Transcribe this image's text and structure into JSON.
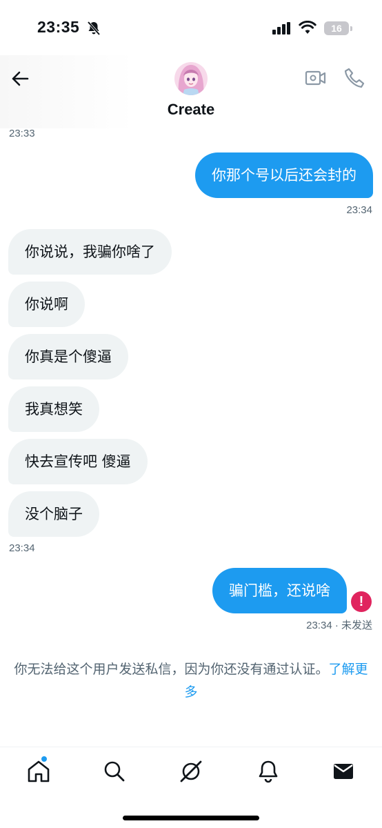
{
  "status_bar": {
    "time": "23:35",
    "battery": "16"
  },
  "header": {
    "contact_name": "Create",
    "icons": [
      "back-arrow-icon",
      "video-call-icon",
      "phone-call-icon"
    ]
  },
  "messages": {
    "first_timestamp": "23:33",
    "out_1": {
      "text": "你那个号以后还会封的",
      "time": "23:34"
    },
    "incoming": [
      "你说说，我骗你啥了",
      "你说啊",
      "你真是个傻逼",
      "我真想笑",
      "快去宣传吧 傻逼",
      "没个脑子"
    ],
    "incoming_time": "23:34",
    "out_2": {
      "text": "骗门槛，还说啥",
      "time": "23:34 · 未发送"
    }
  },
  "notice": {
    "text": "你无法给这个用户发送私信，因为你还没有通过认证。",
    "link": "了解更多"
  },
  "colors": {
    "accent": "#1d9bf0",
    "incoming_bubble": "#eff3f4",
    "error": "#e0245e"
  },
  "nav": [
    "home-icon",
    "search-icon",
    "grok-icon",
    "notifications-icon",
    "messages-icon"
  ]
}
